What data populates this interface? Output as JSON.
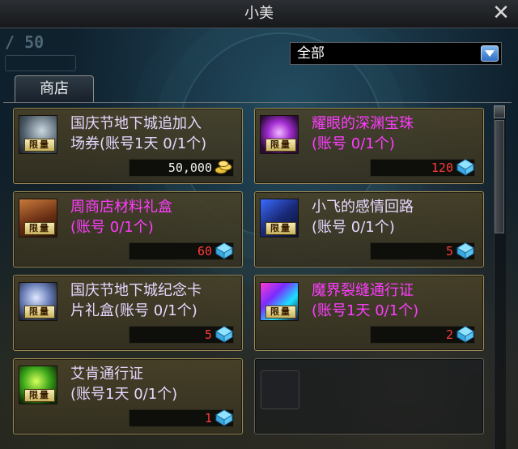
{
  "window": {
    "title": "小美"
  },
  "page_indicator": {
    "text": "/ 50"
  },
  "filter": {
    "selected": "全部"
  },
  "tabs": [
    {
      "label": "商店"
    }
  ],
  "items": [
    {
      "name": "国庆节地下城追加入\n场券(账号1天 0/1个)",
      "name_color": "#e6d8ff",
      "price": "50,000",
      "price_color": "#f2f2f2",
      "currency_icon": "gold-coins-icon",
      "badge": "限量",
      "icon": "ticket-icon"
    },
    {
      "name": "耀眼的深渊宝珠\n(账号 0/1个)",
      "name_color": "#ff3cff",
      "price": "120",
      "price_color": "#ff3b3b",
      "currency_icon": "cera-gem-icon",
      "badge": "限量",
      "icon": "purple-orb-icon"
    },
    {
      "name": "周商店材料礼盒\n(账号 0/1个)",
      "name_color": "#ff3cff",
      "price": "60",
      "price_color": "#ff3b3b",
      "currency_icon": "cera-gem-icon",
      "badge": "限量",
      "icon": "treasure-chest-icon"
    },
    {
      "name": "小飞的感情回路\n(账号 0/1个)",
      "name_color": "#e6d8ff",
      "price": "5",
      "price_color": "#ff3b3b",
      "currency_icon": "cera-gem-icon",
      "badge": "限量",
      "icon": "circuit-icon"
    },
    {
      "name": "国庆节地下城纪念卡\n片礼盒(账号 0/1个)",
      "name_color": "#e6d8ff",
      "price": "5",
      "price_color": "#ff3b3b",
      "currency_icon": "cera-gem-icon",
      "badge": "限量",
      "icon": "card-box-icon"
    },
    {
      "name": "魔界裂缝通行证\n(账号1天 0/1个)",
      "name_color": "#ff3cff",
      "price": "2",
      "price_color": "#ff3b3b",
      "currency_icon": "cera-gem-icon",
      "badge": "限量",
      "icon": "rift-pass-icon"
    },
    {
      "name": "艾肯通行证\n(账号1天 0/1个)",
      "name_color": "#e6d8ff",
      "price": "1",
      "price_color": "#ff3b3b",
      "currency_icon": "cera-gem-icon",
      "badge": "限量",
      "icon": "green-pass-icon"
    }
  ],
  "colors": {
    "card_border": "#9c8a55",
    "accent_blue": "#2f6ec2"
  }
}
